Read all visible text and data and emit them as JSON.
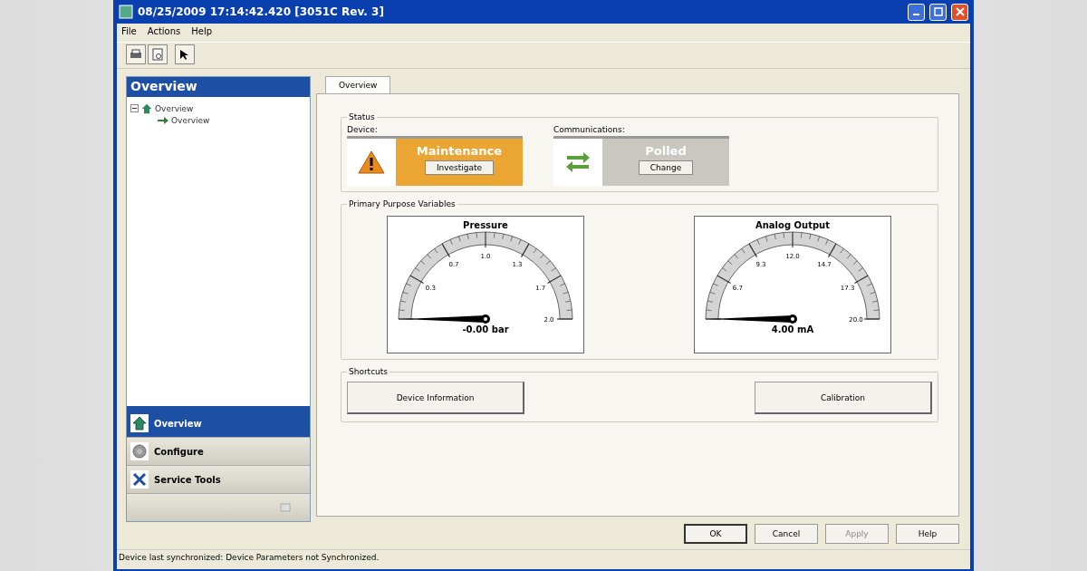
{
  "window": {
    "title": "08/25/2009 17:14:42.420 [3051C Rev. 3]"
  },
  "menu": [
    "File",
    "Actions",
    "Help"
  ],
  "sidebar": {
    "title": "Overview",
    "tree": [
      {
        "label": "Overview",
        "expanded": true,
        "children": [
          {
            "label": "Overview"
          }
        ]
      }
    ],
    "nav": [
      {
        "label": "Overview",
        "kind": "home",
        "selected": true
      },
      {
        "label": "Configure",
        "kind": "gear",
        "selected": false
      },
      {
        "label": "Service Tools",
        "kind": "tools",
        "selected": false
      }
    ]
  },
  "tabs": [
    {
      "label": "Overview",
      "selected": true
    }
  ],
  "status": {
    "title": "Status",
    "items": [
      {
        "label": "Device:",
        "kind": "warning",
        "state": "Maintenance",
        "color": "#eaa532",
        "button": "Investigate"
      },
      {
        "label": "Communications:",
        "kind": "arrows",
        "state": "Polled",
        "color": "#c9c7bf",
        "button": "Change"
      }
    ]
  },
  "variables": {
    "title": "Primary Purpose Variables",
    "gauges": [
      {
        "title": "Pressure",
        "scale_labels": [
          "0.3",
          "0.7",
          "1.0",
          "1.3",
          "1.7",
          "2.0"
        ],
        "reading": "-0.00 bar"
      },
      {
        "title": "Analog Output",
        "scale_labels": [
          "6.7",
          "9.3",
          "12.0",
          "14.7",
          "17.3",
          "20.0"
        ],
        "reading": "4.00 mA"
      }
    ]
  },
  "shortcuts": {
    "title": "Shortcuts",
    "buttons": [
      "Device Information",
      "Calibration"
    ]
  },
  "buttons": [
    {
      "label": "OK",
      "disabled": false
    },
    {
      "label": "Cancel",
      "disabled": false
    },
    {
      "label": "Apply",
      "disabled": true
    },
    {
      "label": "Help",
      "disabled": false
    }
  ],
  "status_bar": "Device last synchronized: Device Parameters not Synchronized."
}
